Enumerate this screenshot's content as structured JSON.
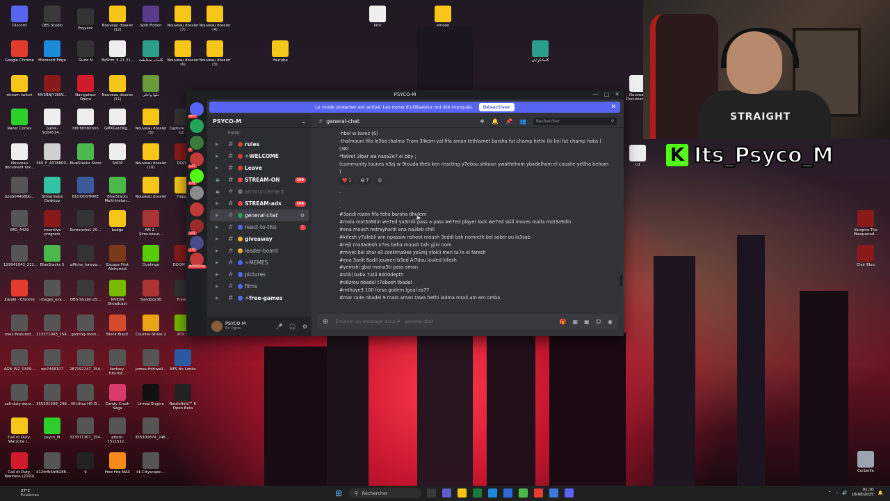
{
  "desktop": {
    "icons": [
      {
        "label": "Discord",
        "color": "#5865f2"
      },
      {
        "label": "OBS Studio",
        "color": "#3a3a3a"
      },
      {
        "label": "Psyy4cc",
        "color": "#333333"
      },
      {
        "label": "Nouveau dossier (12)",
        "color": "#f5c518"
      },
      {
        "label": "Split Fiction",
        "color": "#5a3a8a"
      },
      {
        "label": "Nouveau dossier (7)",
        "color": "#f5c518"
      },
      {
        "label": "Nouveau dossier (4)",
        "color": "#f5c518"
      },
      {
        "label": "kick",
        "color": "#eeeeee"
      },
      {
        "label": "emooo",
        "color": "#f5c518"
      },
      {
        "label": "Google Chrome",
        "color": "#e33b2e"
      },
      {
        "label": "Microsoft Edge",
        "color": "#1b8ad8"
      },
      {
        "label": "Guito N",
        "color": "#333333"
      },
      {
        "label": "BsShm_5.21.21...",
        "color": "#eeeeee"
      },
      {
        "label": "كلمات متقاطعة",
        "color": "#2d9e8a"
      },
      {
        "label": "Nouveau dossier (6)",
        "color": "#f5c518"
      },
      {
        "label": "Nouveau dossier (3)",
        "color": "#f5c518"
      },
      {
        "label": "Youtube",
        "color": "#f5c518"
      },
      {
        "label": "كلماتكراش",
        "color": "#2d9e8a"
      },
      {
        "label": "stream twitch",
        "color": "#f5c518"
      },
      {
        "label": "MV5BNjY2NW...",
        "color": "#8a1a1a"
      },
      {
        "label": "Navigateur Opera",
        "color": "#d11a2a"
      },
      {
        "label": "Nouveau dossier (11)",
        "color": "#f5c518"
      },
      {
        "label": "حلوا واحلى",
        "color": "#6a9a3a"
      },
      {
        "label": "Razer Cortex",
        "color": "#2bd02b"
      },
      {
        "label": "panel-5014514...",
        "color": "#eeeeee"
      },
      {
        "label": "hhhhhhhhhhh",
        "color": "#eeeeee"
      },
      {
        "label": "GMXGxlzWg...",
        "color": "#eeeeee"
      },
      {
        "label": "Nouveau dossier (5)",
        "color": "#f5c518"
      },
      {
        "label": "Capture 2024-12...",
        "color": "#333333"
      },
      {
        "label": "Nouveau document tex...",
        "color": "#eeeeee"
      },
      {
        "label": "360_F_4078800...",
        "color": "#d0d0d0"
      },
      {
        "label": "BlueStacks Store",
        "color": "#4bb84b"
      },
      {
        "label": "SHOP",
        "color": "#eeeeee"
      },
      {
        "label": "Nouveau dossier (10)",
        "color": "#f5c518"
      },
      {
        "label": "DOOM",
        "color": "#8a1a1a"
      },
      {
        "label": "b2db044b8bb...",
        "color": "#555555"
      },
      {
        "label": "Streamlabs Desktop",
        "color": "#31c3a2"
      },
      {
        "label": "BLOODSTRIKE",
        "color": "#3a5a9a"
      },
      {
        "label": "BlueStacks Multi-Instan...",
        "color": "#4bb84b"
      },
      {
        "label": "Nouveau dossier",
        "color": "#f5c518"
      },
      {
        "label": "Happy",
        "color": "#f5c518"
      },
      {
        "label": "IMG_4429",
        "color": "#555555"
      },
      {
        "label": "incentive program",
        "color": "#8a1a1a"
      },
      {
        "label": "Screenshot_20...",
        "color": "#333333"
      },
      {
        "label": "badge",
        "color": "#f5c518"
      },
      {
        "label": "AM 2 - Simulateur...",
        "color": "#aa3333"
      },
      {
        "label": "129941043_212...",
        "color": "#555555"
      },
      {
        "label": "BlueStacks 5",
        "color": "#4bb84b"
      },
      {
        "label": "affiche_hamza...",
        "color": "#333333"
      },
      {
        "label": "Escape First Alchemist",
        "color": "#7a3a1a"
      },
      {
        "label": "Duolingo",
        "color": "#58cc02"
      },
      {
        "label": "DOOM The",
        "color": "#8a1a1a"
      },
      {
        "label": "Zaraki - Chrome",
        "color": "#e33b2e"
      },
      {
        "label": "images_ezy...",
        "color": "#555555"
      },
      {
        "label": "OBS-Studio-25...",
        "color": "#3a3a3a"
      },
      {
        "label": "NVIDIA Broadcast",
        "color": "#76b900"
      },
      {
        "label": "Sandbox3D",
        "color": "#aa3333"
      },
      {
        "label": "Frame",
        "color": "#333333"
      },
      {
        "label": "mw2-featured...",
        "color": "#555555"
      },
      {
        "label": "313371943_154...",
        "color": "#555555"
      },
      {
        "label": "gaming-room...",
        "color": "#555555"
      },
      {
        "label": "Block Blast!",
        "color": "#d44a2a"
      },
      {
        "label": "Counter-Strike 2",
        "color": "#e8a317"
      },
      {
        "label": "RTX R",
        "color": "#76b900"
      },
      {
        "label": "AGB_WZ_0309...",
        "color": "#555555"
      },
      {
        "label": "wp7448107",
        "color": "#555555"
      },
      {
        "label": "287192247_154...",
        "color": "#555555"
      },
      {
        "label": "fantasy-futurist...",
        "color": "#555555"
      },
      {
        "label": "james-thirlwell...",
        "color": "#555555"
      },
      {
        "label": "NFS No Limits",
        "color": "#2a5aa0"
      },
      {
        "label": "call-duty-warz...",
        "color": "#555555"
      },
      {
        "label": "355331508_248...",
        "color": "#555555"
      },
      {
        "label": "4K-Ultra-HD-D...",
        "color": "#555555"
      },
      {
        "label": "Candy Crush Saga",
        "color": "#d83a6a"
      },
      {
        "label": "Unreal Engine",
        "color": "#111111"
      },
      {
        "label": "Battlefield™ 6 Open Beta",
        "color": "#222222"
      },
      {
        "label": "Call of Duty, Warzone (...",
        "color": "#f5c518"
      },
      {
        "label": "psyco_M",
        "color": "#2bd02b"
      },
      {
        "label": "313371307_154...",
        "color": "#555555"
      },
      {
        "label": "photo-1511512...",
        "color": "#555555"
      },
      {
        "label": "355300874_248...",
        "color": "#555555"
      },
      {
        "label": "Call of Duty, Warzone (2020)",
        "color": "#d11a2a"
      },
      {
        "label": "412fcfb5bf8288...",
        "color": "#555555"
      },
      {
        "label": "9",
        "color": "#222222"
      },
      {
        "label": "Free Fire MAX",
        "color": "#f58a1a"
      },
      {
        "label": "4k-Cityscape-...",
        "color": "#555555"
      },
      {
        "label": "Nouveau Document...",
        "color": "#eeeeee"
      },
      {
        "label": "cd",
        "color": "#eeeeee"
      },
      {
        "label": "Vampire The Masquerad...",
        "color": "#8a1a1a"
      },
      {
        "label": "Clair Bloo",
        "color": "#8a1a1a"
      },
      {
        "label": "Corbeille",
        "color": "#9aa4b0"
      }
    ]
  },
  "stream": {
    "banner_name": "Its_Psyco_M",
    "kick_letter": "K",
    "shirt_text": "STRAIGHT"
  },
  "discord": {
    "window_title": "PSYCO-M",
    "streamer_notice": "Le mode streamer est activé. Les noms d'utilisateur ont été tronqués.",
    "streamer_button": "Désactiver",
    "server_name": "PSYCO-M",
    "category": "Public",
    "channels": [
      {
        "label": "rules",
        "prefix": "▶",
        "emoji_color": "#d83c3e",
        "style": "bold",
        "count": ""
      },
      {
        "label": "✧WELCOME",
        "prefix": "▶",
        "emoji_color": "#d83c3e",
        "style": "bold",
        "count": ""
      },
      {
        "label": "Leave",
        "prefix": "▶",
        "emoji_color": "#d83c3e",
        "style": "bold",
        "count": ""
      },
      {
        "label": "STREAM-ON",
        "prefix": "🔈",
        "emoji_color": "#f23f43",
        "style": "bold",
        "count": "199"
      },
      {
        "label": "announcement",
        "prefix": "🔈",
        "emoji_color": "#6d6f78",
        "style": "muted",
        "count": ""
      },
      {
        "label": "STREAM-ads",
        "prefix": "▶",
        "emoji_color": "#f23f43",
        "style": "bold",
        "count": "264"
      },
      {
        "label": "general-chat",
        "prefix": "▶",
        "emoji_color": "#23a559",
        "style": "active",
        "count": ""
      },
      {
        "label": "react-to-this",
        "prefix": "▶",
        "emoji_color": "#5865f2",
        "style": "normal",
        "count": "1"
      },
      {
        "label": "giveaway",
        "prefix": "▶",
        "emoji_color": "#f0b232",
        "style": "bold",
        "count": ""
      },
      {
        "label": "leader-board",
        "prefix": "▶",
        "emoji_color": "#f0b232",
        "style": "normal",
        "count": ""
      },
      {
        "label": "✧MEMES",
        "prefix": "▶",
        "emoji_color": "#5865f2",
        "style": "normal",
        "count": ""
      },
      {
        "label": "pictures",
        "prefix": "▶",
        "emoji_color": "#5865f2",
        "style": "normal",
        "count": ""
      },
      {
        "label": "films",
        "prefix": "▶",
        "emoji_color": "#5865f2",
        "style": "normal",
        "count": ""
      },
      {
        "label": "✧free-games",
        "prefix": "▶",
        "emoji_color": "#5865f2",
        "style": "bold",
        "count": ""
      }
    ],
    "servers": [
      {
        "color": "#5865f2",
        "badge": "9K+"
      },
      {
        "color": "#23a559",
        "badge": ""
      },
      {
        "color": "#3a7a3a",
        "badge": "2"
      },
      {
        "color": "#c23a3a",
        "badge": "247"
      },
      {
        "color": "#53fc18",
        "badge": "249"
      },
      {
        "color": "#8a8a8a",
        "badge": ""
      },
      {
        "color": "#c23a3a",
        "badge": ""
      },
      {
        "color": "#9a2a2a",
        "badge": "193"
      },
      {
        "color": "#4a4a8a",
        "badge": "370"
      },
      {
        "color": "#c23a3a",
        "badge": "NOUVEAU"
      }
    ],
    "user": {
      "name": "PSYCO-M",
      "status": "En ligne"
    },
    "chat": {
      "channel": "general-chat",
      "search_placeholder": "Rechercher",
      "lines": [
        "-hbel w karez (6)",
        "-thalmouni fifa le3ba thalma 7ram 3likom yal fifa aman tethlamet barsha fut champ hethi (ki kol fut champ haka )",
        "(38)",
        "*fa9ret 3ibar wa nasa2e7 el bby ;",
        "(community tounes n3aj w 9rouda theb ken reacting y7ebou shkoun ywathehom ybadelhom el coushe yetlha behom",
        ")"
      ],
      "reactions": [
        {
          "emoji": "❤️",
          "count": "1"
        },
        {
          "emoji": "😆",
          "count": "7"
        },
        {
          "emoji": "☺",
          "count": ""
        }
      ],
      "dots": [
        ".",
        ".",
        "."
      ],
      "lines2": [
        "#3andi rozen fifa feha barsha dhulem",
        "#mala mot3a9din we7ed ya3mili pass a pass we7ed player lock we7ed skill moves malla mot3a9din",
        "#ena moush netrayhardi ena na3leb chill",
        "#kifesh y7alebli win npassiw nshoot moush 3eddi bsh nomreth bel soker  ou la3sab",
        "#rejli ma3adesh n7es beha moush bsh yjini nom",
        "#miyet bel shar eli contrina9es yoSrej yfokli men ta7e el faresh",
        "#ena 3adit 8adil jouweri b3ed Al7dou louled kifesh",
        "#yemshi gbal mana3ti pass aman",
        "#shbi baba 7atli  8000depth",
        "#o8zrou nbadel t7ebesh tbadel",
        "#mthaye3 100 forsa godem lgoal za77",
        "#mar ra3e nbadel 9 mars aman tawa hethi la3ma mta3 am em omba"
      ],
      "composer_placeholder": "Envoyer un message dans # · general-chat"
    }
  },
  "taskbar": {
    "weather_temp": "27°C",
    "weather_desc": "Éclaircies",
    "search_placeholder": "Rechercher",
    "time": "01:10",
    "date": "16/08/2025",
    "apps": [
      {
        "color": "#3a3a3a"
      },
      {
        "color": "#5b5fc7"
      },
      {
        "color": "#f5c518"
      },
      {
        "color": "#1a7a3a"
      },
      {
        "color": "#1b8ad8"
      },
      {
        "color": "#2a6ad8"
      },
      {
        "color": "#4bb84b"
      },
      {
        "color": "#e33b2e"
      },
      {
        "color": "#3a7ad8"
      },
      {
        "color": "#5865f2"
      }
    ]
  }
}
